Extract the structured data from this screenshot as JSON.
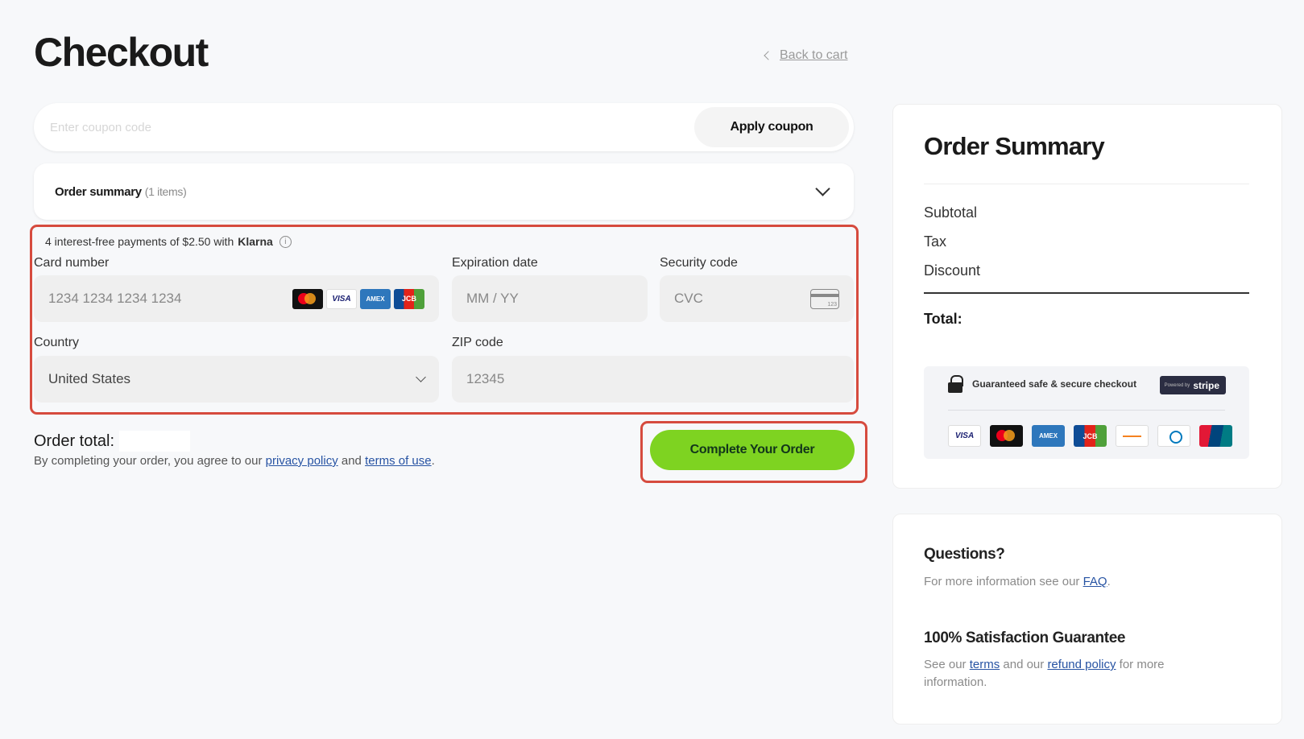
{
  "page": {
    "title": "Checkout",
    "back_link": "Back to cart"
  },
  "coupon": {
    "placeholder": "Enter coupon code",
    "button": "Apply coupon"
  },
  "order_summary_accordion": {
    "label": "Order summary",
    "count": "(1 items)"
  },
  "payment": {
    "klarna_prefix": "4 interest-free payments of $2.50 with",
    "klarna_brand": "Klarna",
    "info_symbol": "i",
    "card_number_label": "Card number",
    "card_number_placeholder": "1234 1234 1234 1234",
    "card_brands": [
      "VISA",
      "AMEX",
      "JCB"
    ],
    "expiration_label": "Expiration date",
    "expiration_placeholder": "MM / YY",
    "security_label": "Security code",
    "security_placeholder": "CVC",
    "country_label": "Country",
    "country_value": "United States",
    "zip_label": "ZIP code",
    "zip_value": "12345"
  },
  "footer": {
    "order_total_label": "Order total:",
    "terms_prefix": "By completing your order, you agree to our",
    "privacy_link": "privacy policy",
    "terms_and": "and",
    "terms_link": "terms of use",
    "terms_suffix": ".",
    "complete_button": "Complete Your Order"
  },
  "summary": {
    "title": "Order Summary",
    "subtotal": "Subtotal",
    "tax": "Tax",
    "discount": "Discount",
    "total": "Total:",
    "secure_text": "Guaranteed safe & secure checkout",
    "stripe_powered": "Powered by",
    "stripe_brand": "stripe",
    "pay_logos": [
      "VISA",
      "AMEX",
      "JCB"
    ]
  },
  "help": {
    "questions_title": "Questions?",
    "questions_prefix": "For more information see our",
    "faq_link": "FAQ",
    "questions_suffix": ".",
    "guarantee_title": "100% Satisfaction Guarantee",
    "guarantee_prefix": "See our",
    "terms_link": "terms",
    "guarantee_and": "and our",
    "refund_link": "refund policy",
    "guarantee_suffix": "for more information."
  },
  "colors": {
    "accent_green": "#7ed321",
    "highlight_red": "#d64b3e",
    "link_blue": "#2753a3"
  }
}
